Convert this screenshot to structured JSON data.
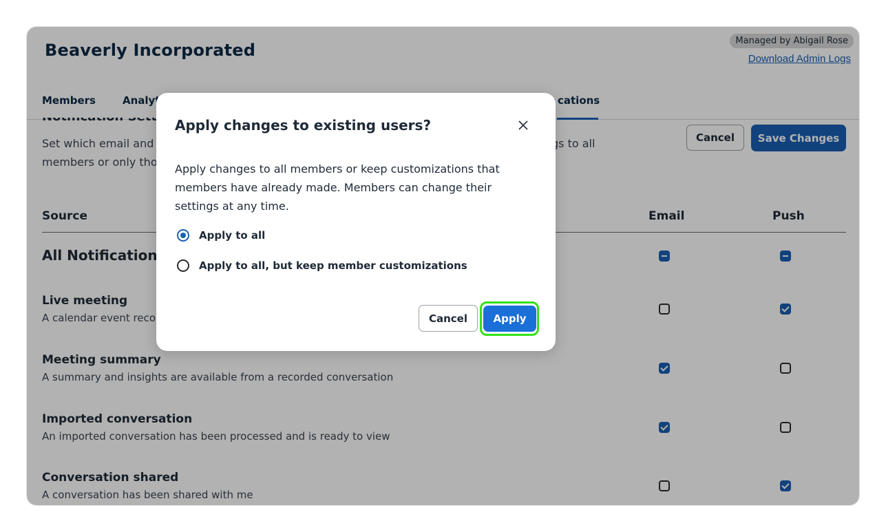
{
  "org": {
    "title": "Beaverly Incorporated",
    "managed_by": "Managed by Abigail Rose",
    "admin_logs_link": "Download Admin Logs"
  },
  "tabs": [
    {
      "label": "Members"
    },
    {
      "label": "Analyti"
    },
    {
      "label": "cations",
      "active": true
    }
  ],
  "section": {
    "title": "Notification Setti",
    "desc_line1": "Set which email and",
    "desc_tail": "gs to all",
    "desc_line2": "members or only tho"
  },
  "actions": {
    "cancel": "Cancel",
    "save": "Save Changes"
  },
  "table": {
    "headers": {
      "source": "Source",
      "email": "Email",
      "push": "Push"
    },
    "rows": [
      {
        "title": "All Notifications",
        "desc": "",
        "email": "mixed",
        "push": "mixed"
      },
      {
        "title": "Live meeting",
        "desc": "A calendar event recorc",
        "email": "unchecked",
        "push": "checked"
      },
      {
        "title": "Meeting summary",
        "desc": "A summary and insights are available from a recorded conversation",
        "email": "checked",
        "push": "unchecked"
      },
      {
        "title": "Imported conversation",
        "desc": "An imported conversation has been processed and is ready to view",
        "email": "checked",
        "push": "unchecked"
      },
      {
        "title": "Conversation shared",
        "desc": "A conversation has been shared with me",
        "email": "unchecked",
        "push": "checked"
      }
    ]
  },
  "modal": {
    "title": "Apply changes to existing users?",
    "close_icon": "close-icon",
    "body": "Apply changes to all members or keep customizations that members have already made. Members can change their settings at any time.",
    "options": [
      {
        "label": "Apply to all",
        "selected": true
      },
      {
        "label": "Apply to all, but keep member customizations",
        "selected": false
      }
    ],
    "cancel": "Cancel",
    "apply": "Apply"
  },
  "colors": {
    "accent": "#1a5fb4",
    "highlight_ring": "#34e016",
    "overlay": "rgba(0,0,0,0.30)"
  }
}
